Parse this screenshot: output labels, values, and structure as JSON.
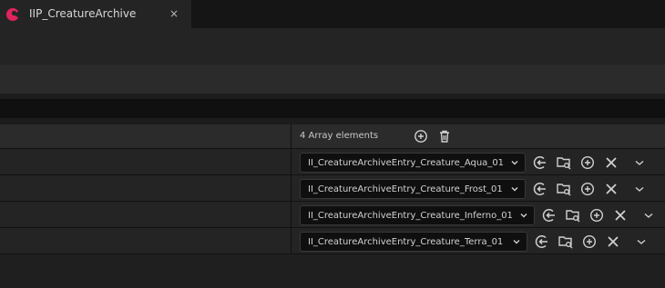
{
  "tab": {
    "title": "IIP_CreatureArchive",
    "close": "×",
    "icon": "asset-icon",
    "accent": "#e0245e"
  },
  "array": {
    "count_label": "4 Array elements",
    "elements": [
      {
        "value": "II_CreatureArchiveEntry_Creature_Aqua_01"
      },
      {
        "value": "II_CreatureArchiveEntry_Creature_Frost_01"
      },
      {
        "value": "II_CreatureArchiveEntry_Creature_Inferno_01"
      },
      {
        "value": "II_CreatureArchiveEntry_Creature_Terra_01"
      }
    ]
  },
  "colors": {
    "background": "#1a1a1a",
    "icon": "#d0d0d0"
  }
}
